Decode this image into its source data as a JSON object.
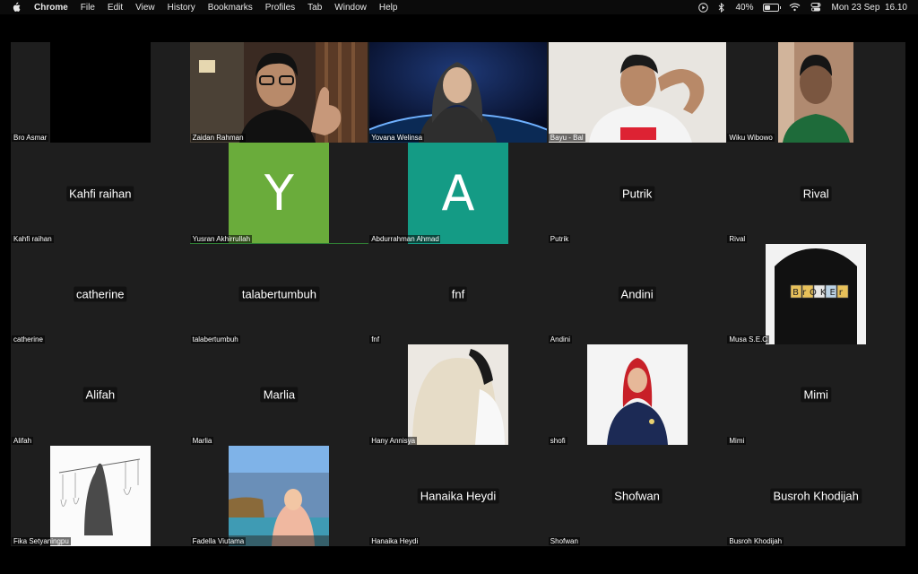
{
  "menubar": {
    "app": "Chrome",
    "items": [
      "File",
      "Edit",
      "View",
      "History",
      "Bookmarks",
      "Profiles",
      "Tab",
      "Window",
      "Help"
    ],
    "battery": "40%",
    "battery_level": 0.4,
    "datetime": "Mon 23 Sep  16.10",
    "icons": [
      "apple-icon",
      "play-icon",
      "bluetooth-icon",
      "battery-icon",
      "wifi-icon",
      "control-center-icon"
    ]
  },
  "participants": [
    {
      "label": "Bro Asmar",
      "display": "",
      "type": "video-black"
    },
    {
      "label": "Zaidan Rahman",
      "display": "",
      "type": "video"
    },
    {
      "label": "Yovana Welinsa",
      "display": "",
      "type": "video"
    },
    {
      "label": "Bayu - Bal",
      "display": "",
      "type": "video"
    },
    {
      "label": "Wiku Wibowo",
      "display": "",
      "type": "video"
    },
    {
      "label": "Kahfi raihan",
      "display": "Kahfi raihan",
      "type": "name"
    },
    {
      "label": "Yusran Akhirrullah",
      "display": "Y",
      "type": "avatar",
      "color": "#6aac3b"
    },
    {
      "label": "Abdurrahman Ahmad",
      "display": "A",
      "type": "avatar",
      "color": "#149b85"
    },
    {
      "label": "Putrik",
      "display": "Putrik",
      "type": "name"
    },
    {
      "label": "Rival",
      "display": "Rival",
      "type": "name"
    },
    {
      "label": "catherine",
      "display": "catherine",
      "type": "name"
    },
    {
      "label": "talabertumbuh",
      "display": "talabertumbuh",
      "type": "name"
    },
    {
      "label": "fnf",
      "display": "fnf",
      "type": "name"
    },
    {
      "label": "Andini",
      "display": "Andini",
      "type": "name"
    },
    {
      "label": "Musa S.E.C",
      "display": "",
      "type": "photo",
      "logo_text": "BrOKEr"
    },
    {
      "label": "Alifah",
      "display": "Alifah",
      "type": "name"
    },
    {
      "label": "Marlia",
      "display": "Marlia",
      "type": "name"
    },
    {
      "label": "Hany Annisya",
      "display": "",
      "type": "photo"
    },
    {
      "label": "shofi",
      "display": "",
      "type": "photo"
    },
    {
      "label": "Mimi",
      "display": "Mimi",
      "type": "name"
    },
    {
      "label": "Fika Setyaningpu",
      "display": "",
      "type": "photo"
    },
    {
      "label": "Fadella Viutama",
      "display": "",
      "type": "photo"
    },
    {
      "label": "Hanaika Heydi",
      "display": "Hanaika Heydi",
      "type": "name"
    },
    {
      "label": "Shofwan",
      "display": "Shofwan",
      "type": "name"
    },
    {
      "label": "Busroh Khodijah",
      "display": "Busroh Khodijah",
      "type": "name"
    }
  ]
}
